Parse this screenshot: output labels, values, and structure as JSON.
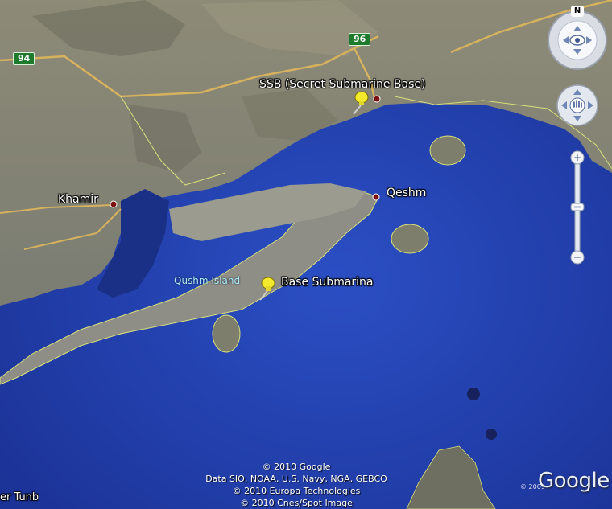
{
  "map": {
    "colors": {
      "sea": "#2441b3",
      "land": "#8d8b79",
      "island": "#9a9a90",
      "road": "#d6b25f",
      "border": "#d8e07a"
    }
  },
  "places": {
    "ssb": "SSB  (Secret Submarine Base)",
    "qeshm": "Qeshm",
    "khamir": "Khamir",
    "base_submarina": "Base Submarina",
    "qushm_island": "Qushm Island",
    "tunb_partial": "er Tunb"
  },
  "roads": {
    "r94": "94",
    "r96": "96"
  },
  "credits": {
    "line1": "© 2010 Google",
    "line2": "Data SIO, NOAA, U.S. Navy, NGA, GEBCO",
    "line3": "© 2010 Europa Technologies",
    "line4": "© 2010 Cnes/Spot Image"
  },
  "logo": {
    "text": "Google",
    "year": "© 2009"
  },
  "compass": {
    "north": "N"
  },
  "icons": {
    "pin": "yellow-pushpin-icon",
    "dot": "city-dot-icon",
    "look": "eye-icon",
    "move": "hand-icon"
  }
}
